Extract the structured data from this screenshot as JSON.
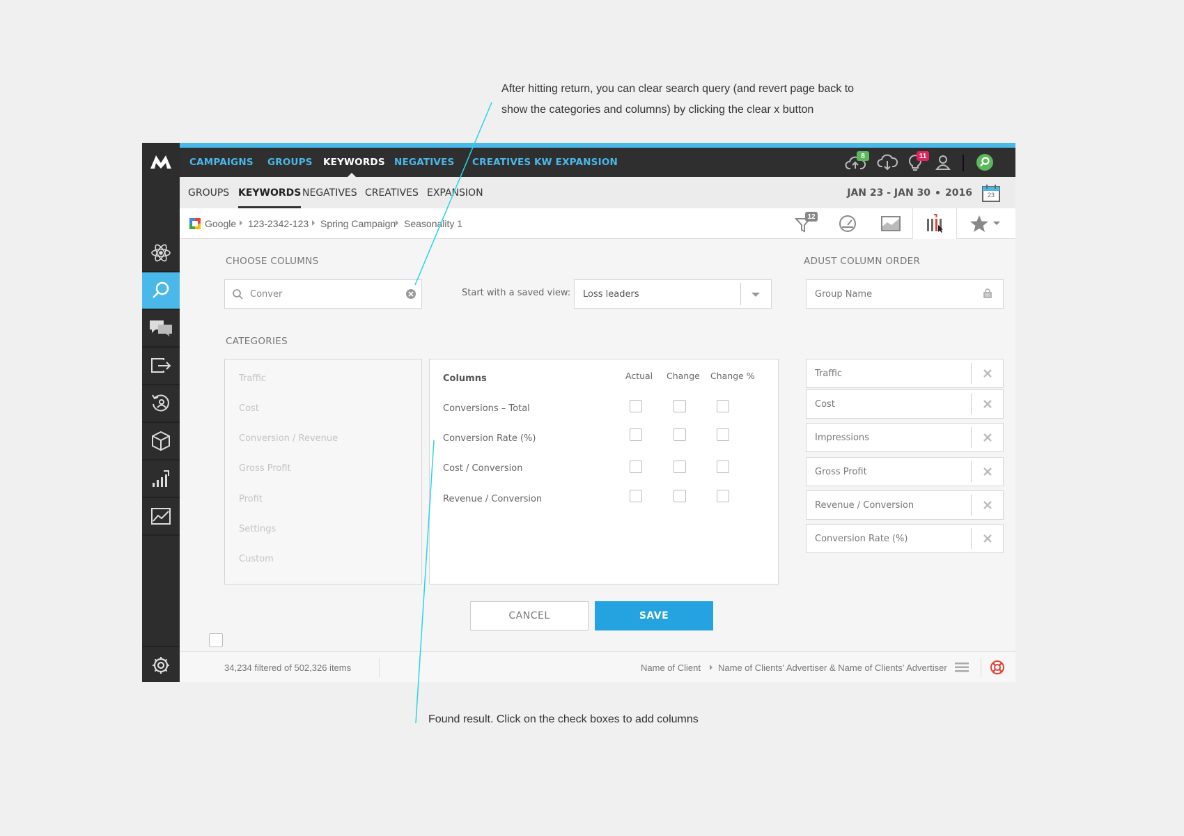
{
  "annotations": {
    "top_note_line1": "After hitting return, you can clear search query (and revert page back to",
    "top_note_line2": "show the categories and columns) by clicking the clear x button",
    "bottom_note": "Found result. Click on the check boxes to add columns",
    "line_color": "#29d4e8"
  },
  "colors": {
    "accent": "#4ab8e8",
    "primary_button": "#25a3e0",
    "topbar": "#2f2f2f",
    "sidebar": "#2d2d2d",
    "badge_green": "#5cb85c",
    "badge_red": "#e0245e"
  },
  "top_nav": {
    "items": [
      {
        "label": "CAMPAIGNS",
        "active": false
      },
      {
        "label": "GROUPS",
        "active": false
      },
      {
        "label": "KEYWORDS",
        "active": true
      },
      {
        "label": "NEGATIVES",
        "active": false
      },
      {
        "label": "CREATIVES",
        "active": false
      },
      {
        "label": "KW EXPANSION",
        "active": false
      }
    ],
    "cloud_upload_badge": "8",
    "alerts_badge": "11"
  },
  "sub_nav": {
    "items": [
      {
        "label": "GROUPS",
        "active": false
      },
      {
        "label": "KEYWORDS",
        "active": true
      },
      {
        "label": "NEGATIVES",
        "active": false
      },
      {
        "label": "CREATIVES",
        "active": false
      },
      {
        "label": "EXPANSION",
        "active": false
      }
    ],
    "date_range": "JAN 23 - JAN 30",
    "year": "2016",
    "calendar_day": "23"
  },
  "breadcrumb": {
    "items": [
      "Google",
      "123-2342-123",
      "Spring Campaign",
      "Seasonality 1"
    ],
    "filter_badge": "12"
  },
  "choose_columns": {
    "title": "CHOOSE COLUMNS",
    "search_value": "Conver",
    "saved_view_label": "Start with a saved view:",
    "saved_view_value": "Loss leaders"
  },
  "categories": {
    "title": "CATEGORIES",
    "items": [
      "Traffic",
      "Cost",
      "Conversion / Revenue",
      "Gross Profit",
      "Profit",
      "Settings",
      "Custom"
    ]
  },
  "columns_table": {
    "headers": [
      "Columns",
      "Actual",
      "Change",
      "Change %"
    ],
    "rows": [
      "Conversions – Total",
      "Conversion Rate (%)",
      "Cost / Conversion",
      "Revenue / Conversion"
    ]
  },
  "column_order": {
    "title": "ADUST COLUMN ORDER",
    "locked_item": "Group Name",
    "items": [
      "Traffic",
      "Cost",
      "Impressions",
      "Gross Profit",
      "Revenue / Conversion",
      "Conversion Rate (%)"
    ]
  },
  "buttons": {
    "cancel": "CANCEL",
    "save": "SAVE"
  },
  "footer": {
    "count": "34,234 filtered of 502,326 items",
    "client": "Name of Client",
    "advertiser": "Name of Clients' Advertiser & Name of Clients' Advertiser"
  }
}
